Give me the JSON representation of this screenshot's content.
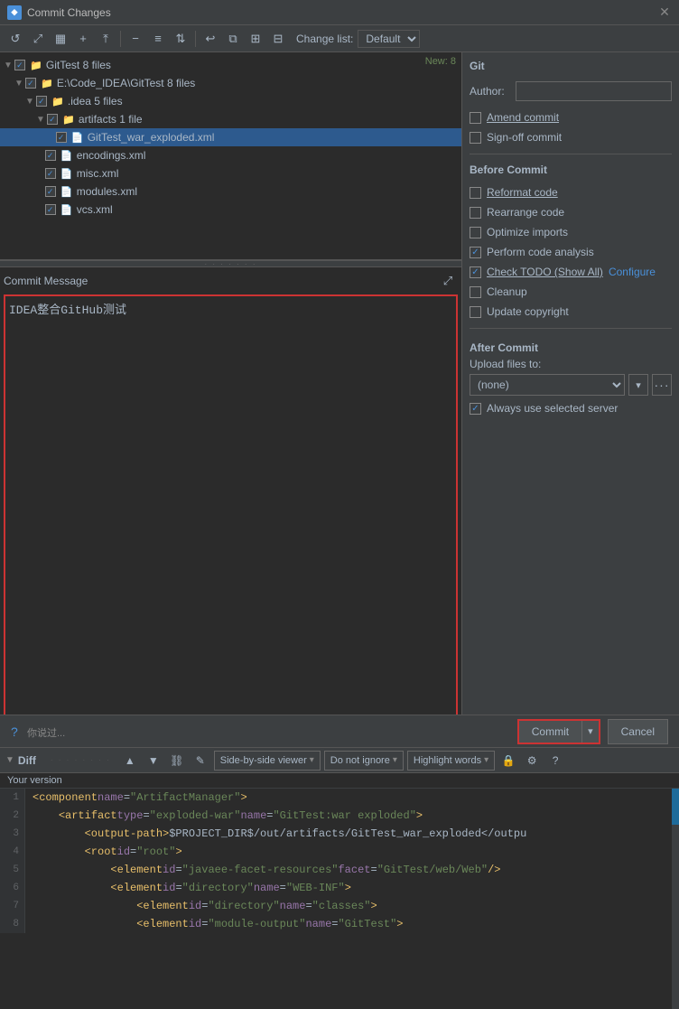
{
  "window": {
    "title": "Commit Changes",
    "icon": "git"
  },
  "toolbar": {
    "changelist_label": "Change list:",
    "changelist_value": "Default"
  },
  "filetree": {
    "new_badge": "New: 8",
    "items": [
      {
        "indent": 0,
        "label": "GitTest  8 files",
        "type": "folder",
        "checked": true,
        "expanded": true
      },
      {
        "indent": 1,
        "label": "E:\\Code_IDEA\\GitTest  8 files",
        "type": "folder",
        "checked": true,
        "expanded": true
      },
      {
        "indent": 2,
        "label": ".idea  5 files",
        "type": "folder",
        "checked": true,
        "expanded": true
      },
      {
        "indent": 3,
        "label": "artifacts  1 file",
        "type": "folder",
        "checked": true,
        "expanded": true
      },
      {
        "indent": 4,
        "label": "GitTest_war_exploded.xml",
        "type": "xml",
        "checked": true,
        "selected": true
      },
      {
        "indent": 3,
        "label": "encodings.xml",
        "type": "xml",
        "checked": true
      },
      {
        "indent": 3,
        "label": "misc.xml",
        "type": "xml",
        "checked": true
      },
      {
        "indent": 3,
        "label": "modules.xml",
        "type": "xml",
        "checked": true
      },
      {
        "indent": 3,
        "label": "vcs.xml",
        "type": "xml",
        "checked": true
      }
    ]
  },
  "commit_message": {
    "label": "Commit Message",
    "value": "IDEA整合GitHub测试",
    "placeholder": "Commit message"
  },
  "git_panel": {
    "title": "Git",
    "author_label": "Author:",
    "author_value": "",
    "options": [
      {
        "id": "amend",
        "label": "Amend commit",
        "checked": false,
        "underline": true
      },
      {
        "id": "signoff",
        "label": "Sign-off commit",
        "checked": false,
        "underline": false
      }
    ],
    "before_commit": {
      "title": "Before Commit",
      "options": [
        {
          "id": "reformat",
          "label": "Reformat code",
          "checked": false,
          "underline": true
        },
        {
          "id": "rearrange",
          "label": "Rearrange code",
          "checked": false,
          "underline": false
        },
        {
          "id": "optimize",
          "label": "Optimize imports",
          "checked": false,
          "underline": false
        },
        {
          "id": "codeanalysis",
          "label": "Perform code analysis",
          "checked": true,
          "underline": false
        },
        {
          "id": "checktodo",
          "label": "Check TODO (Show All)",
          "checked": true,
          "underline": true,
          "configure": "Configure"
        },
        {
          "id": "cleanup",
          "label": "Cleanup",
          "checked": false,
          "underline": false
        },
        {
          "id": "copyright",
          "label": "Update copyright",
          "checked": false,
          "underline": false
        }
      ]
    },
    "after_commit": {
      "title": "After Commit",
      "upload_label": "Upload files to:",
      "server_value": "(none)",
      "always_use": {
        "label": "Always use selected server",
        "checked": true
      }
    }
  },
  "diff": {
    "title": "Diff",
    "version_label": "Your version",
    "viewer_dropdown": "Side-by-side viewer",
    "ignore_dropdown": "Do not ignore",
    "highlight_dropdown": "Highlight words",
    "code_lines": [
      {
        "num": "1",
        "content": "<component name=\"ArtifactManager\">"
      },
      {
        "num": "2",
        "content": "    <artifact type=\"exploded-war\" name=\"GitTest:war exploded\">"
      },
      {
        "num": "3",
        "content": "        <output-path>$PROJECT_DIR$/out/artifacts/GitTest_war_exploded</output-path"
      },
      {
        "num": "4",
        "content": "        <root id=\"root\">"
      },
      {
        "num": "5",
        "content": "            <element id=\"javaee-facet-resources\" facet=\"GitTest/web/Web\" />"
      },
      {
        "num": "6",
        "content": "            <element id=\"directory\" name=\"WEB-INF\">"
      },
      {
        "num": "7",
        "content": "                <element id=\"directory\" name=\"classes\">"
      },
      {
        "num": "8",
        "content": "                <element id=\"module-output\" name=\"GitTest\">"
      }
    ]
  },
  "bottom": {
    "commit_label": "Commit",
    "commit_arrow": "▾",
    "cancel_label": "Cancel",
    "bottom_text": "你说过..."
  }
}
